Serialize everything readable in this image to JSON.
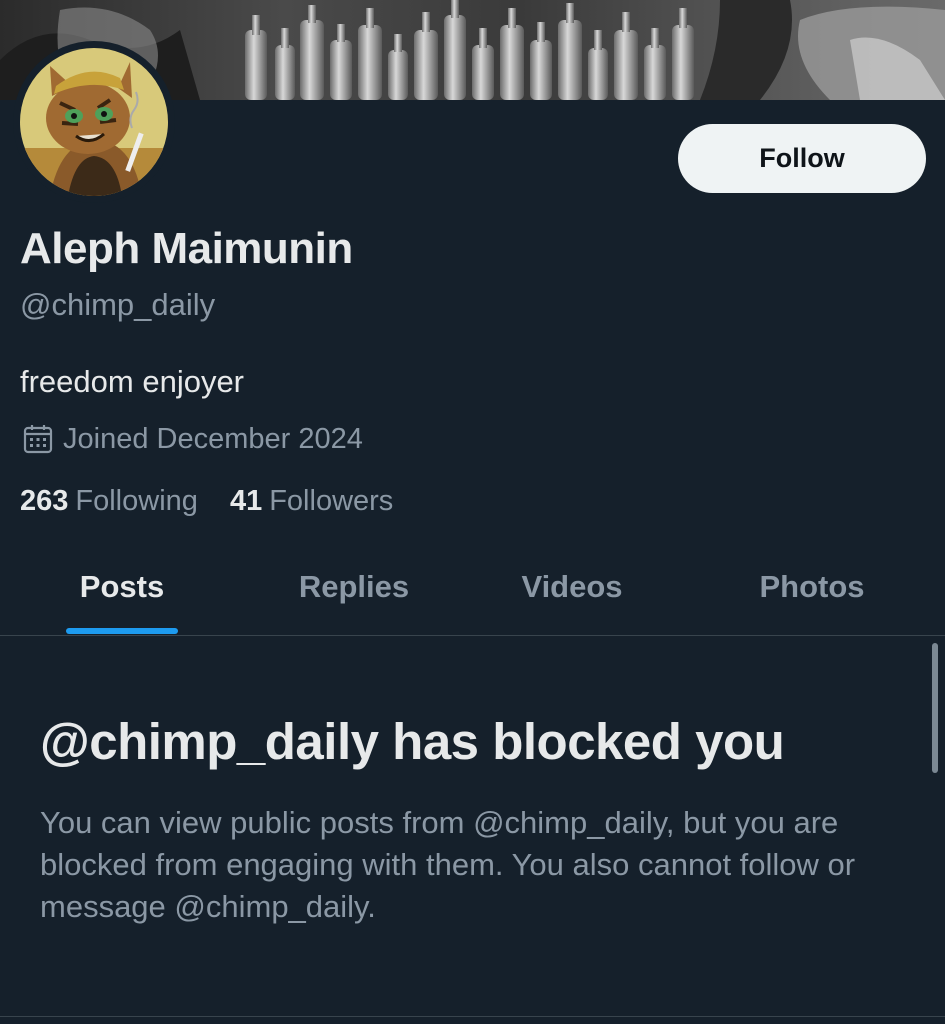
{
  "profile": {
    "display_name": "Aleph Maimunin",
    "handle": "@chimp_daily",
    "bio": "freedom enjoyer",
    "joined": "Joined December 2024",
    "following_count": "263",
    "following_label": "Following",
    "followers_count": "41",
    "followers_label": "Followers"
  },
  "actions": {
    "follow_label": "Follow"
  },
  "tabs": [
    {
      "label": "Posts",
      "active": true
    },
    {
      "label": "Replies",
      "active": false
    },
    {
      "label": "Videos",
      "active": false
    },
    {
      "label": "Photos",
      "active": false
    }
  ],
  "blocked": {
    "title": "@chimp_daily has blocked you",
    "message": "You can view public posts from @chimp_daily, but you are blocked from engaging with them. You also cannot follow or message @chimp_daily."
  },
  "icons": {
    "joined": "calendar-icon"
  },
  "colors": {
    "background": "#15202b",
    "accent": "#1d9bf0",
    "text_primary": "#e7e9ea",
    "text_secondary": "#8b98a5",
    "button_bg": "#eff3f4"
  }
}
